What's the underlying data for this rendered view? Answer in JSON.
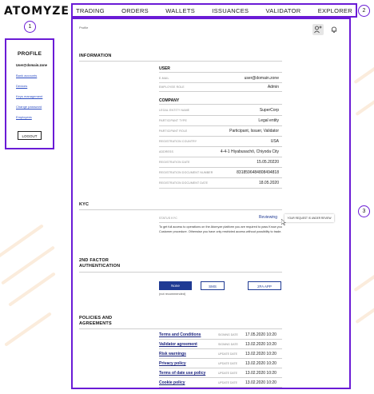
{
  "brand": {
    "logo": "ATOMYZE"
  },
  "nav": {
    "items": [
      "TRADING",
      "ORDERS",
      "WALLETS",
      "ISSUANCES",
      "VALIDATOR",
      "EXPLORER"
    ]
  },
  "callouts": [
    "1",
    "2",
    "3"
  ],
  "sidebar": {
    "title": "PROFILE",
    "email": "User@domain.zone",
    "links": [
      "Bank accounts",
      "Devices",
      "Keys management",
      "Change password",
      "Employees"
    ],
    "logout": "LOGOUT"
  },
  "main": {
    "breadcrumb": "Profile",
    "information": {
      "title": "INFORMATION",
      "user_title": "USER",
      "user_rows": [
        {
          "label": "E-MAIL",
          "value": "user@domain.zone"
        },
        {
          "label": "EMPLOYEE ROLE",
          "value": "Admin"
        }
      ],
      "company_title": "COMPANY",
      "company_rows": [
        {
          "label": "LEGAL ENTITY NAME",
          "value": "SuperCorp"
        },
        {
          "label": "PARTICIPANT TYPE",
          "value": "Legal entity"
        },
        {
          "label": "PARTICIPANT ROLE",
          "value": "Participant, Issuer, Validator"
        },
        {
          "label": "REGISTRATION COUNTRY",
          "value": "USA"
        },
        {
          "label": "ADDRESS",
          "value": "4-4-1 Hiyabusachō, Chiyoda City"
        },
        {
          "label": "REGISTRATION DATE",
          "value": "15.05.20220"
        },
        {
          "label": "REGISTRATION DOCUMENT NUMBER",
          "value": "8318596484808494818"
        },
        {
          "label": "REGISTRATION DOCUMENT DATE",
          "value": "18.05.2020"
        }
      ]
    },
    "kyc": {
      "title": "KYC",
      "status_label": "STATUS KYC",
      "status_value": "Reviewing",
      "tooltip": "YOUR REQUEST IS UNDER REVIEW",
      "description": "To get full access to operations on the Atomyze platform you are required to pass Know you Customer procedure. Otherwise you have only restricted access without possibility to trade."
    },
    "twofa": {
      "title_line1": "2ND FACTOR",
      "title_line2": "AUTHENTICATION",
      "options": [
        "None",
        "SMS",
        "2FA APP"
      ],
      "note": "(not recommended)"
    },
    "policies": {
      "title_line1": "POLICIES AND",
      "title_line2": "AGREEMENTS",
      "rows": [
        {
          "name": "Terms and Conditions",
          "label": "SIGNING DATE",
          "value": "17.05.2020  10:20"
        },
        {
          "name": "Validator agreement",
          "label": "SIGNING DATE",
          "value": "13.02.2020  10:20"
        },
        {
          "name": "Risk warnings",
          "label": "UPDATE DATE",
          "value": "13.02.2020  10:20"
        },
        {
          "name": "Privacy policy",
          "label": "UPDATE DATE",
          "value": "13.02.2020  10:20"
        },
        {
          "name": "Terms of date use policy",
          "label": "UPDATE DATE",
          "value": "13.02.2020  10:20"
        },
        {
          "name": "Cookie policy",
          "label": "UPDATE DATE",
          "value": "13.02.2020  10:20"
        }
      ]
    }
  },
  "colors": {
    "accent": "#6a1bd6",
    "primary_button": "#1f3a93",
    "link": "#1a237e",
    "stripe": "#f7d8b8"
  }
}
